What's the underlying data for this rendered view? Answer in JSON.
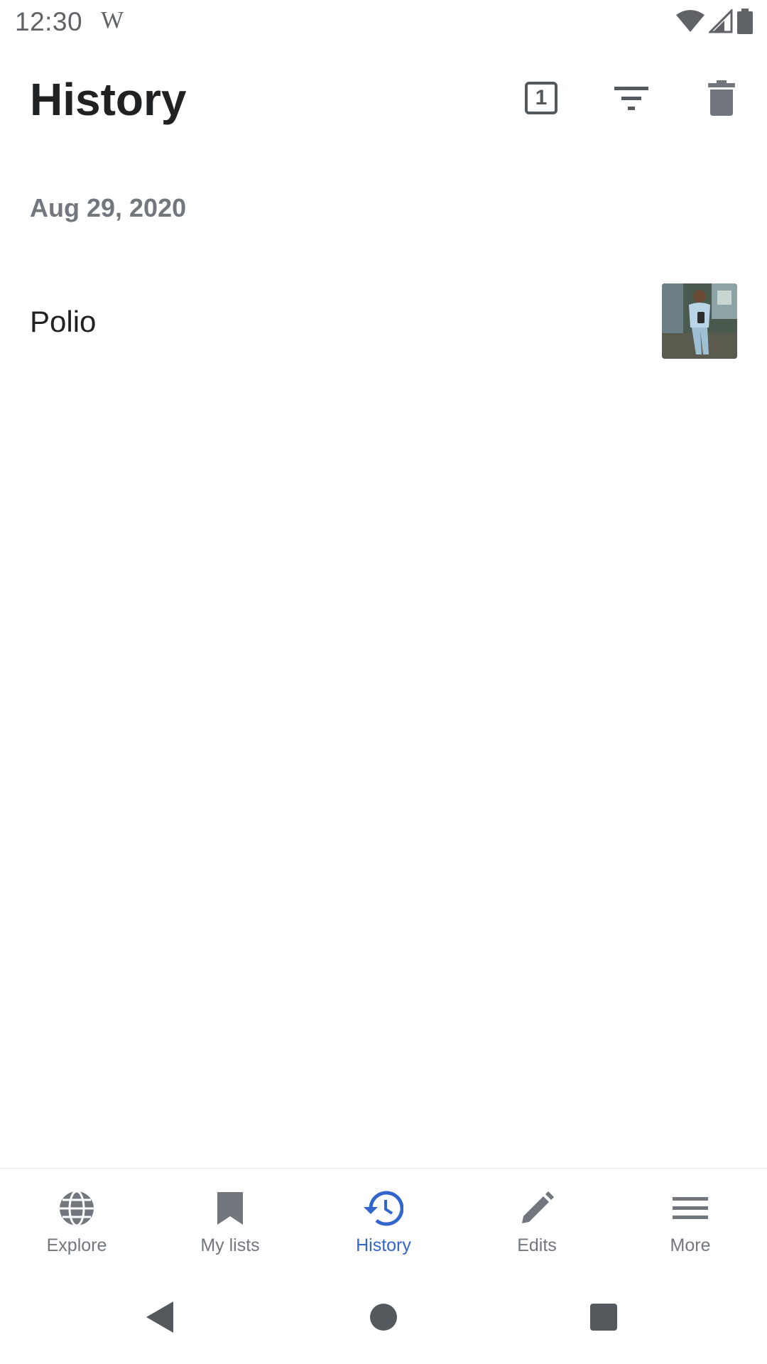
{
  "status_bar": {
    "time": "12:30",
    "app_mark": "W",
    "icons": [
      "wifi-icon",
      "signal-icon",
      "battery-icon"
    ]
  },
  "header": {
    "title": "History",
    "tabs_count": "1",
    "actions": [
      "tabs-icon",
      "filter-icon",
      "trash-icon"
    ]
  },
  "history": {
    "sections": [
      {
        "date": "Aug 29, 2020",
        "items": [
          {
            "title": "Polio",
            "thumbnail": "photo-thumbnail"
          }
        ]
      }
    ]
  },
  "bottom_nav": {
    "items": [
      {
        "label": "Explore",
        "icon": "globe-icon"
      },
      {
        "label": "My lists",
        "icon": "bookmark-icon"
      },
      {
        "label": "History",
        "icon": "history-icon",
        "active": true
      },
      {
        "label": "Edits",
        "icon": "pencil-icon"
      },
      {
        "label": "More",
        "icon": "menu-icon"
      }
    ],
    "active_color": "#3366cc",
    "inactive_color": "#72777d"
  },
  "system_nav": {
    "buttons": [
      "back-icon",
      "home-icon",
      "recents-icon"
    ]
  }
}
